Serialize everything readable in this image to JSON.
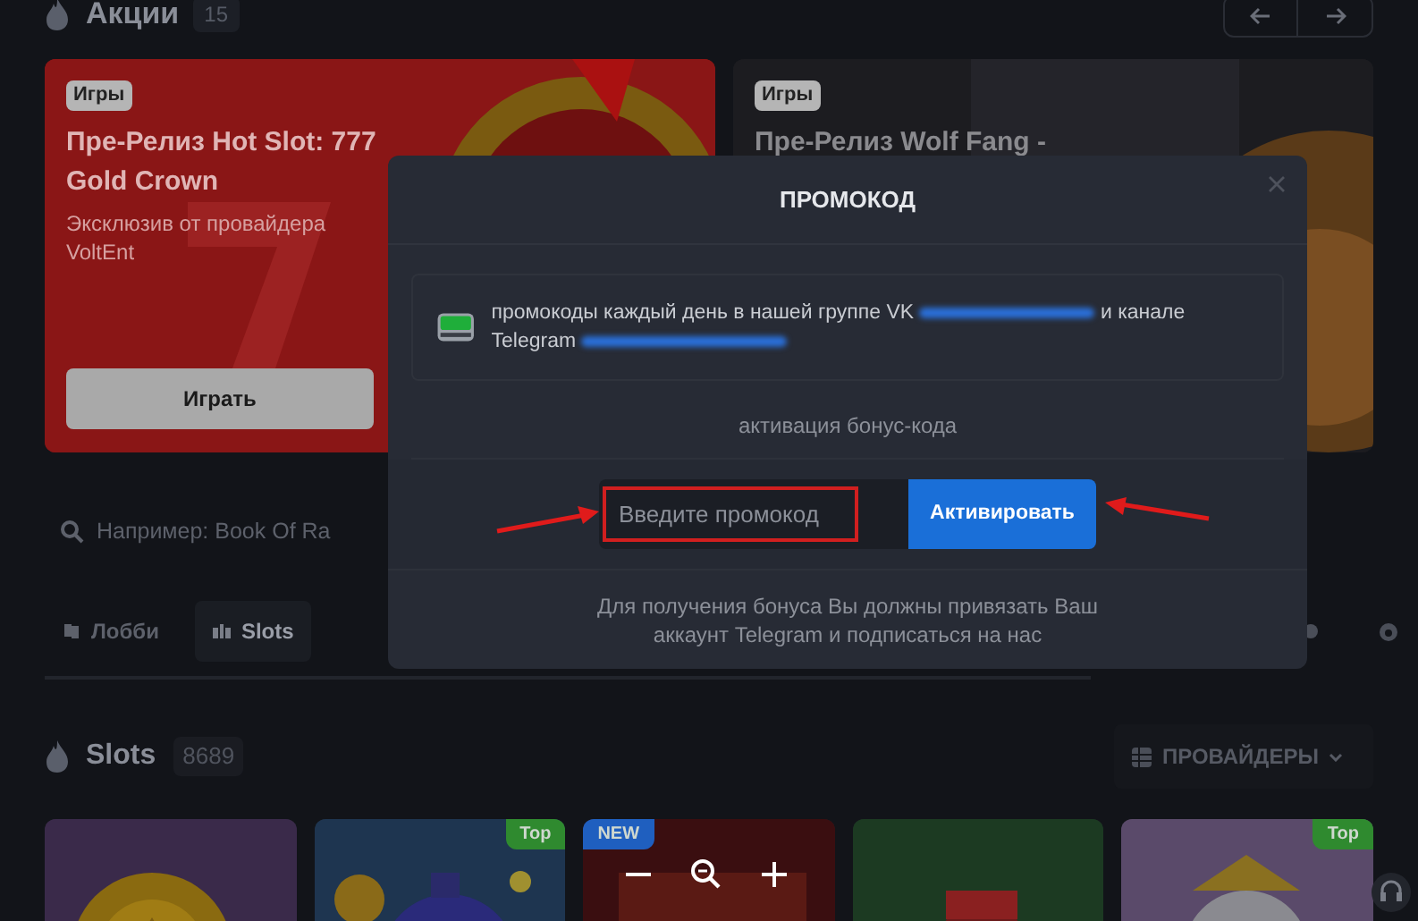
{
  "promos_header": {
    "title": "Акции",
    "count": "15"
  },
  "banners": [
    {
      "tag": "Игры",
      "title": "Пре-Релиз Hot Slot: 777 Gold Crown",
      "subtitle": "Эксклюзив от провайдера VoltEnt",
      "button": "Играть",
      "kind": "red"
    },
    {
      "tag": "Игры",
      "title": "Пре-Релиз Wolf Fang -",
      "kind": "dark"
    }
  ],
  "search": {
    "placeholder": "Например: Book Of Ra"
  },
  "tabs": [
    {
      "label": "Лобби",
      "selected": false
    },
    {
      "label": "Slots",
      "selected": true
    }
  ],
  "section": {
    "title": "Slots",
    "count": "8689",
    "providers_button": "ПРОВАЙДЕРЫ"
  },
  "games": [
    {
      "kind": "picture"
    },
    {
      "kind": "picture",
      "badge": {
        "text": "Top",
        "color": "#2f8a2f"
      }
    },
    {
      "kind": "picture",
      "badge": {
        "text": "NEW",
        "color": "#1f5fbf"
      }
    },
    {
      "kind": "picture"
    },
    {
      "kind": "picture",
      "badge": {
        "text": "Top",
        "color": "#2f8a2f"
      }
    }
  ],
  "modal": {
    "title": "ПРОМОКОД",
    "info": [
      {
        "kind": "text",
        "text": "промокоды каждый день в нашей группе VK"
      },
      {
        "kind": "redacted"
      },
      {
        "kind": "text",
        "text": "и канале Telegram"
      },
      {
        "kind": "redacted"
      }
    ],
    "activation_label": "активация бонус-кода",
    "input": {
      "placeholder": "Введите промокод"
    },
    "submit": "Активировать",
    "note": "Для получения бонуса Вы должны привязать Ваш аккаунт Telegram и подписаться на нас"
  }
}
